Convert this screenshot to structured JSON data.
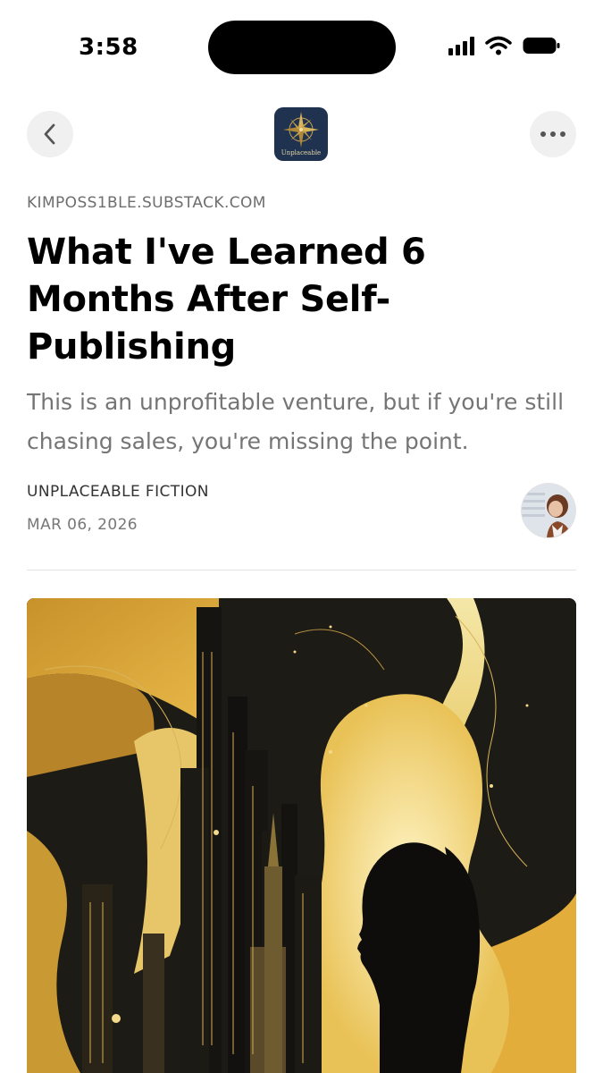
{
  "status_bar": {
    "time": "3:58"
  },
  "nav": {
    "back_icon": "chevron-left-icon",
    "more_icon": "ellipsis-icon",
    "publication_logo_text": "Unplaceable"
  },
  "article": {
    "domain": "KIMPOSS1BLE.SUBSTACK.COM",
    "title": "What I've Learned 6 Months After Self-Publishing",
    "subtitle": "This is an unprofitable venture, but if you're still chasing sales, you're missing the point.",
    "author": "UNPLACEABLE FICTION",
    "date": "MAR 06, 2026"
  },
  "colors": {
    "logo_bg": "#1f3350",
    "logo_gold": "#c9a24d",
    "hero_gold": "#e3b743",
    "hero_dark": "#1d1b16"
  }
}
